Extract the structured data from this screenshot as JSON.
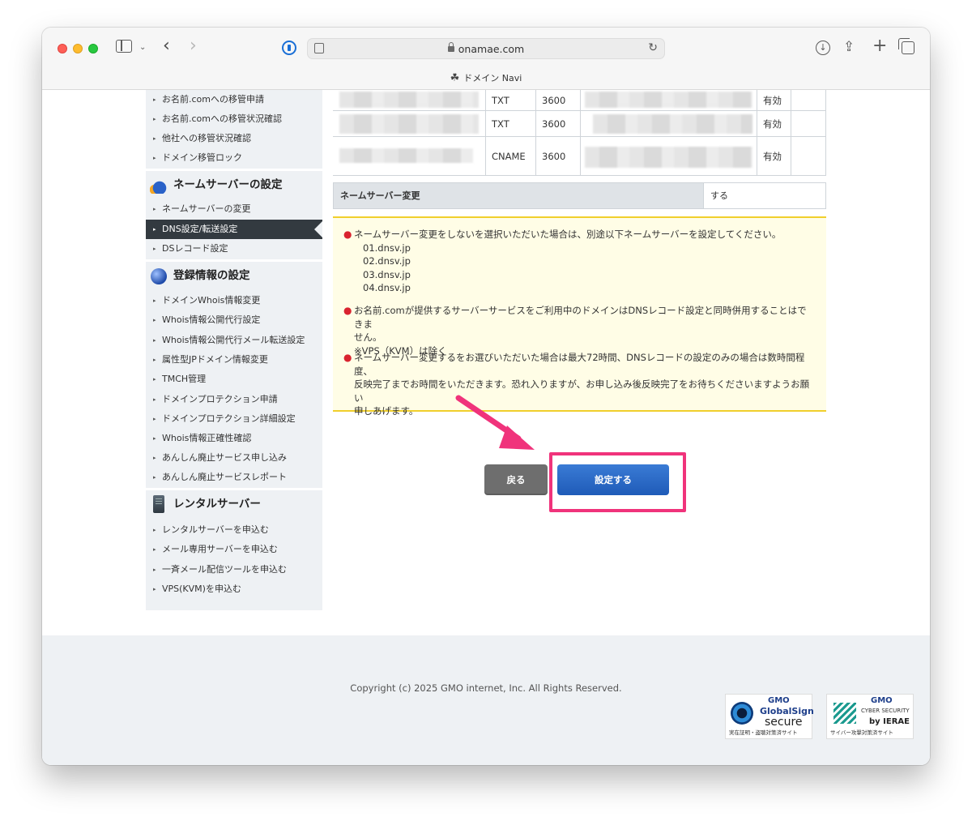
{
  "browser": {
    "url": "onamae.com",
    "tab_title": "ドメイン Navi"
  },
  "sidebar": {
    "transfer_items": [
      "お名前.comへの移管申請",
      "お名前.comへの移管状況確認",
      "他社への移管状況確認",
      "ドメイン移管ロック"
    ],
    "nameserver_heading": "ネームサーバーの設定",
    "nameserver_items": [
      "ネームサーバーの変更",
      "DNS設定/転送設定",
      "DSレコード設定"
    ],
    "registration_heading": "登録情報の設定",
    "registration_items": [
      "ドメインWhois情報変更",
      "Whois情報公開代行設定",
      "Whois情報公開代行メール転送設定",
      "属性型JPドメイン情報変更",
      "TMCH管理",
      "ドメインプロテクション申請",
      "ドメインプロテクション詳細設定",
      "Whois情報正確性確認",
      "あんしん廃止サービス申し込み",
      "あんしん廃止サービスレポート"
    ],
    "rental_heading": "レンタルサーバー",
    "rental_items": [
      "レンタルサーバーを申込む",
      "メール専用サーバーを申込む",
      "一斉メール配信ツールを申込む",
      "VPS(KVM)を申込む"
    ]
  },
  "records": [
    {
      "type": "TXT",
      "ttl": "3600",
      "status": "有効"
    },
    {
      "type": "TXT",
      "ttl": "3600",
      "status": "有効"
    },
    {
      "type": "CNAME",
      "ttl": "3600",
      "status": "有効"
    }
  ],
  "nameserver_change": {
    "label": "ネームサーバー変更",
    "value": "する"
  },
  "notice": {
    "note1": "ネームサーバー変更をしないを選択いただいた場合は、別途以下ネームサーバーを設定してください。",
    "nameservers": [
      "01.dnsv.jp",
      "02.dnsv.jp",
      "03.dnsv.jp",
      "04.dnsv.jp"
    ],
    "note2_line1": "お名前.comが提供するサーバーサービスをご利用中のドメインはDNSレコード設定と同時併用することはできま",
    "note2_line2": "せん。",
    "note2_line3": "※VPS（KVM）は除く",
    "note3_line1": "ネームサーバー変更するをお選びいただいた場合は最大72時間、DNSレコードの設定のみの場合は数時間程度、",
    "note3_line2": "反映完了までお時間をいただきます。恐れ入りますが、お申し込み後反映完了をお待ちくださいますようお願い",
    "note3_line3": "申しあげます。"
  },
  "buttons": {
    "back": "戻る",
    "save": "設定する"
  },
  "footer": {
    "copyright": "Copyright (c) 2025 GMO internet, Inc. All Rights Reserved.",
    "badge1_brand": "GMO",
    "badge1_name": "GlobalSign",
    "badge1_word": "secure",
    "badge1_caption": "実在証明・盗聴対策済サイト",
    "badge2_brand": "GMO",
    "badge2_name": "CYBER SECURITY",
    "badge2_by": "by IERAE",
    "badge2_caption": "サイバー攻撃対策済サイト"
  },
  "colors": {
    "accent_pink": "#f0337b",
    "save_blue": "#1f5bb8",
    "nav_active": "#333a40",
    "notice_bg": "#fffde6",
    "notice_border": "#f0cf2c"
  }
}
